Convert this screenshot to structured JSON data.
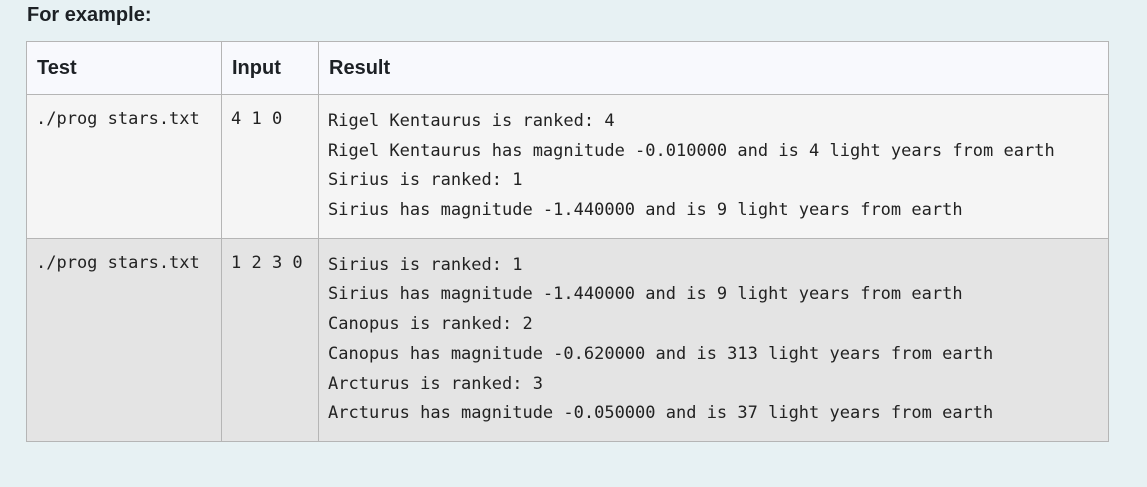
{
  "heading": "For example:",
  "table": {
    "headers": [
      "Test",
      "Input",
      "Result"
    ],
    "rows": [
      {
        "test": "./prog stars.txt",
        "input": "4 1 0",
        "result": [
          "Rigel Kentaurus is ranked: 4",
          "Rigel Kentaurus has magnitude -0.010000 and is 4 light years from earth",
          "Sirius is ranked: 1",
          "Sirius has magnitude -1.440000 and is 9 light years from earth"
        ]
      },
      {
        "test": "./prog stars.txt",
        "input": "1 2 3 0",
        "result": [
          "Sirius is ranked: 1",
          "Sirius has magnitude -1.440000 and is 9 light years from earth",
          "Canopus is ranked: 2",
          "Canopus has magnitude -0.620000 and is 313 light years from earth",
          "Arcturus is ranked: 3",
          "Arcturus has magnitude -0.050000 and is 37 light years from earth"
        ]
      }
    ]
  }
}
